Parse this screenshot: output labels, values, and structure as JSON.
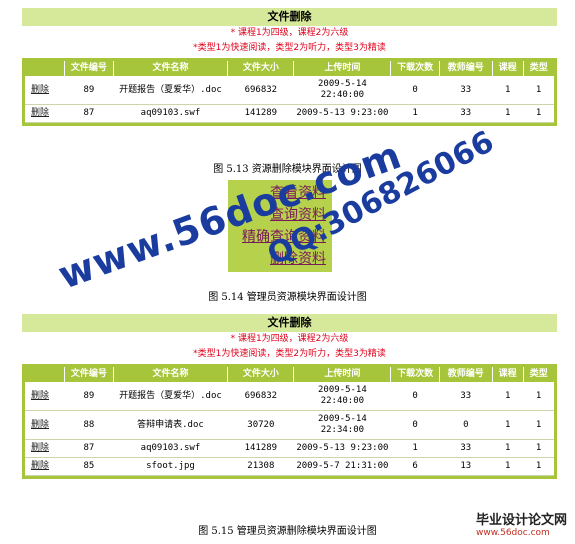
{
  "figure1": {
    "title": "文件删除",
    "notice1": "* 课程1为四级，课程2为六级",
    "notice2": "*类型1为快速阅读，类型2为听力，类型3为精读",
    "headers": [
      "",
      "文件编号",
      "文件名称",
      "文件大小",
      "上传时间",
      "下载次数",
      "教师编号",
      "课程",
      "类型"
    ],
    "rows": [
      {
        "action": "删除",
        "id": "89",
        "name": "开题报告（夏爱华）.doc",
        "size": "696832",
        "time": "2009-5-14 22:40:00",
        "downloads": "0",
        "teacher": "33",
        "course": "1",
        "type": "1"
      },
      {
        "action": "删除",
        "id": "87",
        "name": "aq09103.swf",
        "size": "141289",
        "time": "2009-5-13 9:23:00",
        "downloads": "1",
        "teacher": "33",
        "course": "1",
        "type": "1"
      }
    ],
    "caption": "图 5.13  资源删除模块界面设计图"
  },
  "figure2": {
    "menu": [
      "查看资料",
      "查询资料",
      "精确查询资料",
      "删除资料"
    ],
    "caption": "图 5.14  管理员资源模块界面设计图"
  },
  "figure3": {
    "title": "文件删除",
    "notice1": "* 课程1为四级，课程2为六级",
    "notice2": "*类型1为快速阅读，类型2为听力，类型3为精读",
    "headers": [
      "",
      "文件编号",
      "文件名称",
      "文件大小",
      "上传时间",
      "下载次数",
      "教师编号",
      "课程",
      "类型"
    ],
    "rows": [
      {
        "action": "删除",
        "id": "89",
        "name": "开题报告（夏爱华）.doc",
        "size": "696832",
        "time": "2009-5-14 22:40:00",
        "downloads": "0",
        "teacher": "33",
        "course": "1",
        "type": "1"
      },
      {
        "action": "删除",
        "id": "88",
        "name": "答辩申请表.doc",
        "size": "30720",
        "time": "2009-5-14 22:34:00",
        "downloads": "0",
        "teacher": "0",
        "course": "1",
        "type": "1"
      },
      {
        "action": "删除",
        "id": "87",
        "name": "aq09103.swf",
        "size": "141289",
        "time": "2009-5-13 9:23:00",
        "downloads": "1",
        "teacher": "33",
        "course": "1",
        "type": "1"
      },
      {
        "action": "删除",
        "id": "85",
        "name": "sfoot.jpg",
        "size": "21308",
        "time": "2009-5-7 21:31:00",
        "downloads": "6",
        "teacher": "13",
        "course": "1",
        "type": "1"
      }
    ],
    "caption": "图 5.15  管理员资源删除模块界面设计图"
  },
  "watermark": {
    "text1": "www.56doc.com",
    "text2": "QQ:306826066"
  },
  "logo": {
    "title": "毕业设计论文网",
    "url": "www.56doc.com"
  }
}
